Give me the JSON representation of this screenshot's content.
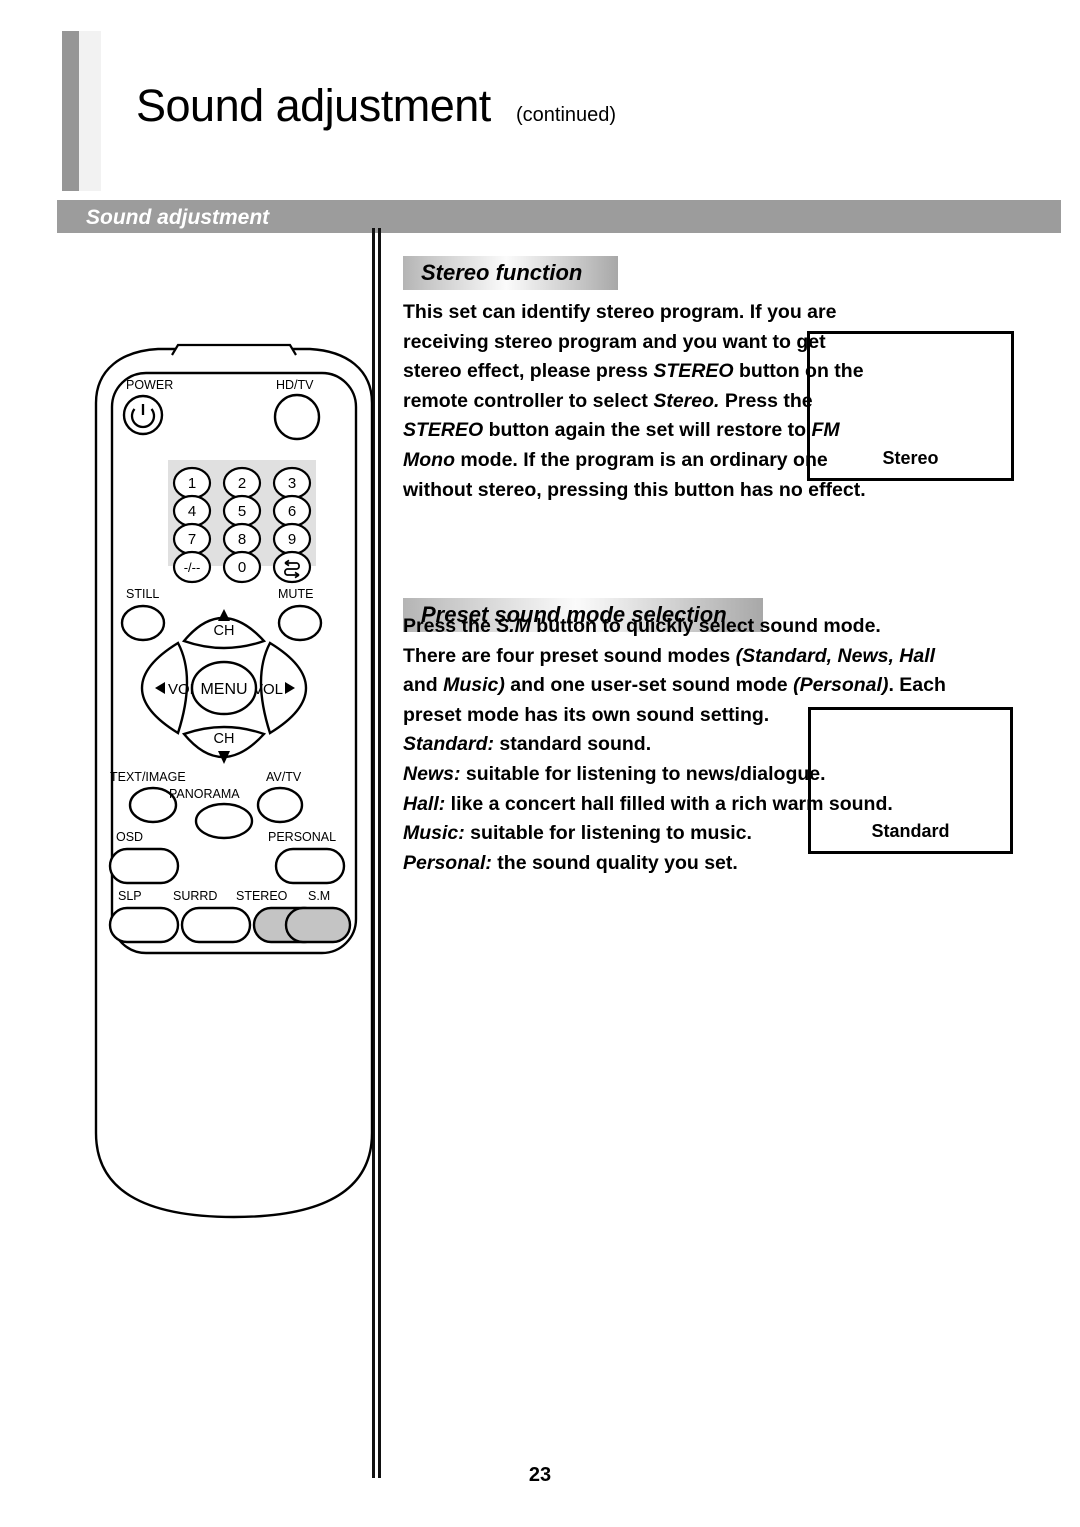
{
  "header": {
    "title": "Sound adjustment",
    "continued": "(continued)",
    "section_bar_label": "Sound adjustment"
  },
  "sections": [
    {
      "id": "stereo",
      "heading": "Stereo function",
      "body": "This set can identify stereo program. If you are receiving stereo program and you want to get stereo effect, please press STEREO button on the remote controller to select Stereo. Press the STEREO button again the set will restore to FM Mono mode. If the program is an ordinary one without stereo, pressing this button has no effect.",
      "screen_label": "Stereo"
    },
    {
      "id": "preset",
      "heading": "Preset sound mode selection",
      "body": "Press the S.M button to quickly select sound mode.\nThere are four preset sound modes (Standard, News, Hall and Music) and one user-set sound mode (Personal). Each preset mode has its own sound setting.\nStandard: standard sound.\nNews: suitable for listening to news/dialogue.\nHall: like a concert hall filled with a rich warm sound.\nMusic: suitable for listening to music.\nPersonal: the sound quality you set.",
      "screen_label": "Standard"
    }
  ],
  "sound_modes": [
    {
      "name": "Standard",
      "description": "standard sound."
    },
    {
      "name": "News",
      "description": "suitable for listening to news/dialogue."
    },
    {
      "name": "Hall",
      "description": "like a concert hall filled with a rich warm sound."
    },
    {
      "name": "Music",
      "description": "suitable for listening to music."
    },
    {
      "name": "Personal",
      "description": "the sound quality you set."
    }
  ],
  "remote": {
    "power_label": "POWER",
    "hdtv_label": "HD/TV",
    "keypad": [
      "1",
      "2",
      "3",
      "4",
      "5",
      "6",
      "7",
      "8",
      "9",
      "-/--",
      "0",
      "recall-icon"
    ],
    "still_label": "STILL",
    "mute_label": "MUTE",
    "ch_up_label": "CH",
    "ch_down_label": "CH",
    "vol_left_label": "VOL",
    "vol_right_label": "VOL",
    "menu_label": "MENU",
    "text_image_label": "TEXT/IMAGE",
    "panorama_label": "PANORAMA",
    "avtv_label": "AV/TV",
    "osd_label": "OSD",
    "personal_label": "PERSONAL",
    "slp_label": "SLP",
    "surrd_label": "SURRD",
    "stereo_label": "STEREO",
    "sm_label": "S.M",
    "highlighted_buttons": [
      "STEREO",
      "S.M"
    ]
  },
  "footer": {
    "page_number": "23"
  },
  "colors": {
    "bar_gray": "#9c9c9c",
    "accent_light_gray": "#f2f2f2",
    "highlight_button": "#c4c4c4",
    "keypad_panel": "#e0e0e0"
  }
}
